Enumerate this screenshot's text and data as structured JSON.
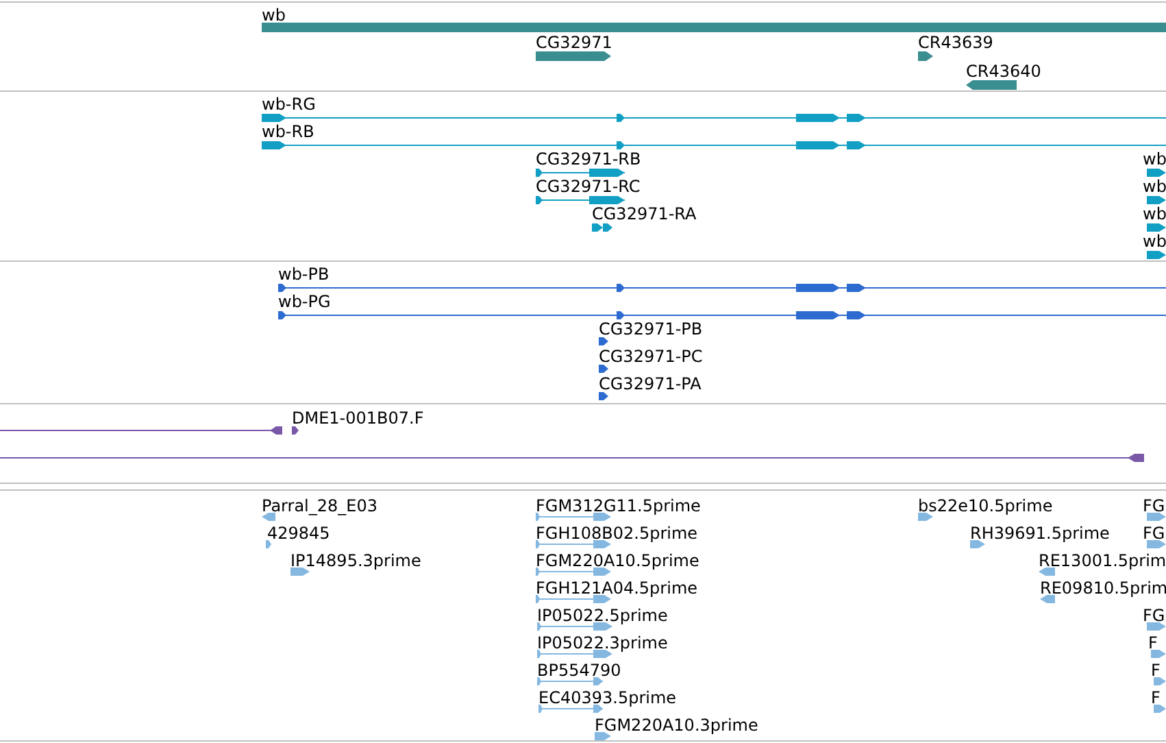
{
  "tracks": [
    {
      "kind": "gene",
      "features": [
        {
          "label": "wb"
        },
        {
          "label": "CG32971",
          "reverse": false
        },
        {
          "label": "CR43639",
          "reverse": false
        },
        {
          "label": "CR43640",
          "reverse": true
        }
      ]
    },
    {
      "kind": "transcript",
      "features": [
        {
          "label": "wb-RG",
          "reverse": false
        },
        {
          "label": "wb-RB",
          "reverse": false
        },
        {
          "label": "CG32971-RB",
          "reverse": false
        },
        {
          "label": "wb",
          "reverse": false
        },
        {
          "label": "CG32971-RC",
          "reverse": false
        },
        {
          "label": "wb",
          "reverse": false
        },
        {
          "label": "CG32971-RA",
          "reverse": false
        },
        {
          "label": "wb",
          "reverse": false
        },
        {
          "label": "wb",
          "reverse": false
        }
      ]
    },
    {
      "kind": "protein",
      "features": [
        {
          "label": "wb-PB",
          "reverse": false
        },
        {
          "label": "wb-PG",
          "reverse": false
        },
        {
          "label": "CG32971-PB",
          "reverse": false
        },
        {
          "label": "CG32971-PC",
          "reverse": false
        },
        {
          "label": "CG32971-PA",
          "reverse": false
        }
      ]
    },
    {
      "kind": "alignment",
      "features": [
        {
          "reverse": true
        },
        {
          "label": "DME1-001B07.F",
          "reverse": false
        },
        {
          "reverse": true
        }
      ]
    },
    {
      "kind": "est",
      "features": [
        {
          "label": "Parral_28_E03",
          "reverse": true
        },
        {
          "label": "FGM312G11.5prime",
          "reverse": false
        },
        {
          "label": "bs22e10.5prime",
          "reverse": false
        },
        {
          "label": "FG",
          "reverse": false
        },
        {
          "label": "429845",
          "reverse": false
        },
        {
          "label": "FGH108B02.5prime",
          "reverse": false
        },
        {
          "label": "RH39691.5prime",
          "reverse": false
        },
        {
          "label": "FG",
          "reverse": false
        },
        {
          "label": "IP14895.3prime",
          "reverse": false
        },
        {
          "label": "FGM220A10.5prime",
          "reverse": false
        },
        {
          "label": "RE13001.5prim",
          "reverse": true
        },
        {
          "label": "FGH121A04.5prime",
          "reverse": false
        },
        {
          "label": "RE09810.5prim",
          "reverse": true
        },
        {
          "label": "IP05022.5prime",
          "reverse": false
        },
        {
          "label": "FG",
          "reverse": false
        },
        {
          "label": "IP05022.3prime",
          "reverse": false
        },
        {
          "label": "F",
          "reverse": false
        },
        {
          "label": "BP554790",
          "reverse": false
        },
        {
          "label": "F",
          "reverse": false
        },
        {
          "label": "EC40393.5prime",
          "reverse": false
        },
        {
          "label": "F",
          "reverse": false
        },
        {
          "label": "FGM220A10.3prime",
          "reverse": false
        }
      ]
    }
  ]
}
